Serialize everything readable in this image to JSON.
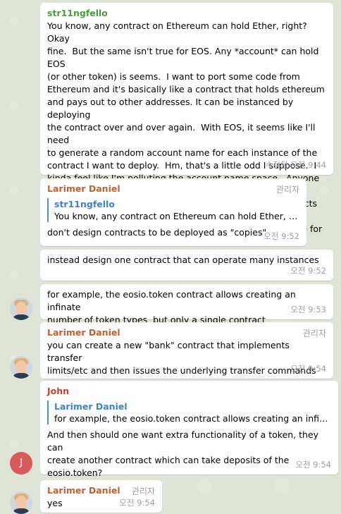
{
  "messages": [
    {
      "sender": "str11ngfello",
      "text": "You know, any contract on Ethereum can hold Ether, right? Okay\nfine.  But the same isn't true for EOS. Any *account* can hold EOS\n(or other token) is seems.  I want to port some code from\nEthereum and it's basically like a contract that holds ethereum\nand pays out to other addresses. It can be instanced by deploying\nthe contract over and over again.  With EOS, it seems like I'll need\nto generate a random account name for each instance of the\ncontract I want to deploy.  Hm, that's a little odd I suppose.  I\nkinda feel like I'm polluting the account name space.  Anyone care\nto comment on a better way to deploy instances of contracts that\ncan hold tokens without having to create an account name for\neach? 🤔",
      "time": "수정됨 오전 9:44"
    },
    {
      "sender": "Larimer Daniel",
      "badge": "관리자",
      "reply_name": "str11ngfello",
      "reply_text": "You know, any contract on Ethereum can hold Ether, rig...",
      "text": "don't design contracts to be deployed as \"copies\"",
      "time": "오전 9:52"
    },
    {
      "text": "instead design one contract that can operate many instances",
      "time": "오전 9:52"
    },
    {
      "text": "for example, the eosio.token contract allows creating an infinate\nnumber of token types  but only a single contract",
      "time": "오전 9:53"
    },
    {
      "sender": "Larimer Daniel",
      "badge": "관리자",
      "text": "you can create a new \"bank\" contract that implements transfer\nlimits/etc and then issues the underlying transfer commands",
      "time": "오전 9:54"
    },
    {
      "sender": "John",
      "reply_name": "Larimer Daniel",
      "reply_text": "for example, the eosio.token contract allows creating an infinat...",
      "text": "And then should one want extra functionality of a token, they can\ncreate another contract which can take deposits of the\neosio.token?",
      "time": "오전 9:54",
      "avatar_letter": "J"
    },
    {
      "sender": "Larimer Daniel",
      "badge": "관리자",
      "text": "yes",
      "time": "오전 9:54"
    }
  ],
  "colors": {
    "background": "#dfe5d6",
    "sender_green": "#4b9b3c",
    "sender_orange": "#c0612b",
    "sender_red": "#c4412f",
    "reply_accent": "#4a8fd6"
  }
}
